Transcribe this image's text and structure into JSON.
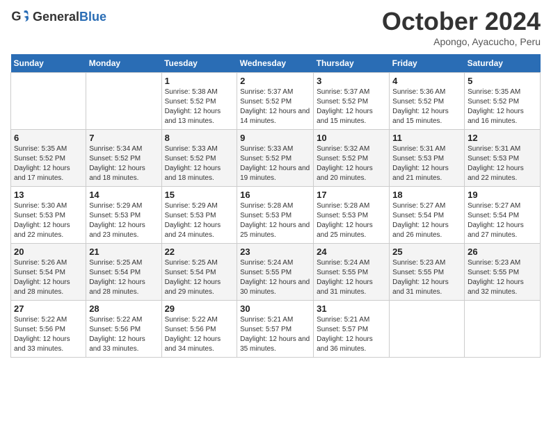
{
  "header": {
    "logo": {
      "general": "General",
      "blue": "Blue"
    },
    "title": "October 2024",
    "subtitle": "Apongo, Ayacucho, Peru"
  },
  "calendar": {
    "weekdays": [
      "Sunday",
      "Monday",
      "Tuesday",
      "Wednesday",
      "Thursday",
      "Friday",
      "Saturday"
    ],
    "weeks": [
      [
        {
          "day": "",
          "sunrise": "",
          "sunset": "",
          "daylight": ""
        },
        {
          "day": "",
          "sunrise": "",
          "sunset": "",
          "daylight": ""
        },
        {
          "day": "1",
          "sunrise": "Sunrise: 5:38 AM",
          "sunset": "Sunset: 5:52 PM",
          "daylight": "Daylight: 12 hours and 13 minutes."
        },
        {
          "day": "2",
          "sunrise": "Sunrise: 5:37 AM",
          "sunset": "Sunset: 5:52 PM",
          "daylight": "Daylight: 12 hours and 14 minutes."
        },
        {
          "day": "3",
          "sunrise": "Sunrise: 5:37 AM",
          "sunset": "Sunset: 5:52 PM",
          "daylight": "Daylight: 12 hours and 15 minutes."
        },
        {
          "day": "4",
          "sunrise": "Sunrise: 5:36 AM",
          "sunset": "Sunset: 5:52 PM",
          "daylight": "Daylight: 12 hours and 15 minutes."
        },
        {
          "day": "5",
          "sunrise": "Sunrise: 5:35 AM",
          "sunset": "Sunset: 5:52 PM",
          "daylight": "Daylight: 12 hours and 16 minutes."
        }
      ],
      [
        {
          "day": "6",
          "sunrise": "Sunrise: 5:35 AM",
          "sunset": "Sunset: 5:52 PM",
          "daylight": "Daylight: 12 hours and 17 minutes."
        },
        {
          "day": "7",
          "sunrise": "Sunrise: 5:34 AM",
          "sunset": "Sunset: 5:52 PM",
          "daylight": "Daylight: 12 hours and 18 minutes."
        },
        {
          "day": "8",
          "sunrise": "Sunrise: 5:33 AM",
          "sunset": "Sunset: 5:52 PM",
          "daylight": "Daylight: 12 hours and 18 minutes."
        },
        {
          "day": "9",
          "sunrise": "Sunrise: 5:33 AM",
          "sunset": "Sunset: 5:52 PM",
          "daylight": "Daylight: 12 hours and 19 minutes."
        },
        {
          "day": "10",
          "sunrise": "Sunrise: 5:32 AM",
          "sunset": "Sunset: 5:52 PM",
          "daylight": "Daylight: 12 hours and 20 minutes."
        },
        {
          "day": "11",
          "sunrise": "Sunrise: 5:31 AM",
          "sunset": "Sunset: 5:53 PM",
          "daylight": "Daylight: 12 hours and 21 minutes."
        },
        {
          "day": "12",
          "sunrise": "Sunrise: 5:31 AM",
          "sunset": "Sunset: 5:53 PM",
          "daylight": "Daylight: 12 hours and 22 minutes."
        }
      ],
      [
        {
          "day": "13",
          "sunrise": "Sunrise: 5:30 AM",
          "sunset": "Sunset: 5:53 PM",
          "daylight": "Daylight: 12 hours and 22 minutes."
        },
        {
          "day": "14",
          "sunrise": "Sunrise: 5:29 AM",
          "sunset": "Sunset: 5:53 PM",
          "daylight": "Daylight: 12 hours and 23 minutes."
        },
        {
          "day": "15",
          "sunrise": "Sunrise: 5:29 AM",
          "sunset": "Sunset: 5:53 PM",
          "daylight": "Daylight: 12 hours and 24 minutes."
        },
        {
          "day": "16",
          "sunrise": "Sunrise: 5:28 AM",
          "sunset": "Sunset: 5:53 PM",
          "daylight": "Daylight: 12 hours and 25 minutes."
        },
        {
          "day": "17",
          "sunrise": "Sunrise: 5:28 AM",
          "sunset": "Sunset: 5:53 PM",
          "daylight": "Daylight: 12 hours and 25 minutes."
        },
        {
          "day": "18",
          "sunrise": "Sunrise: 5:27 AM",
          "sunset": "Sunset: 5:54 PM",
          "daylight": "Daylight: 12 hours and 26 minutes."
        },
        {
          "day": "19",
          "sunrise": "Sunrise: 5:27 AM",
          "sunset": "Sunset: 5:54 PM",
          "daylight": "Daylight: 12 hours and 27 minutes."
        }
      ],
      [
        {
          "day": "20",
          "sunrise": "Sunrise: 5:26 AM",
          "sunset": "Sunset: 5:54 PM",
          "daylight": "Daylight: 12 hours and 28 minutes."
        },
        {
          "day": "21",
          "sunrise": "Sunrise: 5:25 AM",
          "sunset": "Sunset: 5:54 PM",
          "daylight": "Daylight: 12 hours and 28 minutes."
        },
        {
          "day": "22",
          "sunrise": "Sunrise: 5:25 AM",
          "sunset": "Sunset: 5:54 PM",
          "daylight": "Daylight: 12 hours and 29 minutes."
        },
        {
          "day": "23",
          "sunrise": "Sunrise: 5:24 AM",
          "sunset": "Sunset: 5:55 PM",
          "daylight": "Daylight: 12 hours and 30 minutes."
        },
        {
          "day": "24",
          "sunrise": "Sunrise: 5:24 AM",
          "sunset": "Sunset: 5:55 PM",
          "daylight": "Daylight: 12 hours and 31 minutes."
        },
        {
          "day": "25",
          "sunrise": "Sunrise: 5:23 AM",
          "sunset": "Sunset: 5:55 PM",
          "daylight": "Daylight: 12 hours and 31 minutes."
        },
        {
          "day": "26",
          "sunrise": "Sunrise: 5:23 AM",
          "sunset": "Sunset: 5:55 PM",
          "daylight": "Daylight: 12 hours and 32 minutes."
        }
      ],
      [
        {
          "day": "27",
          "sunrise": "Sunrise: 5:22 AM",
          "sunset": "Sunset: 5:56 PM",
          "daylight": "Daylight: 12 hours and 33 minutes."
        },
        {
          "day": "28",
          "sunrise": "Sunrise: 5:22 AM",
          "sunset": "Sunset: 5:56 PM",
          "daylight": "Daylight: 12 hours and 33 minutes."
        },
        {
          "day": "29",
          "sunrise": "Sunrise: 5:22 AM",
          "sunset": "Sunset: 5:56 PM",
          "daylight": "Daylight: 12 hours and 34 minutes."
        },
        {
          "day": "30",
          "sunrise": "Sunrise: 5:21 AM",
          "sunset": "Sunset: 5:57 PM",
          "daylight": "Daylight: 12 hours and 35 minutes."
        },
        {
          "day": "31",
          "sunrise": "Sunrise: 5:21 AM",
          "sunset": "Sunset: 5:57 PM",
          "daylight": "Daylight: 12 hours and 36 minutes."
        },
        {
          "day": "",
          "sunrise": "",
          "sunset": "",
          "daylight": ""
        },
        {
          "day": "",
          "sunrise": "",
          "sunset": "",
          "daylight": ""
        }
      ]
    ]
  }
}
